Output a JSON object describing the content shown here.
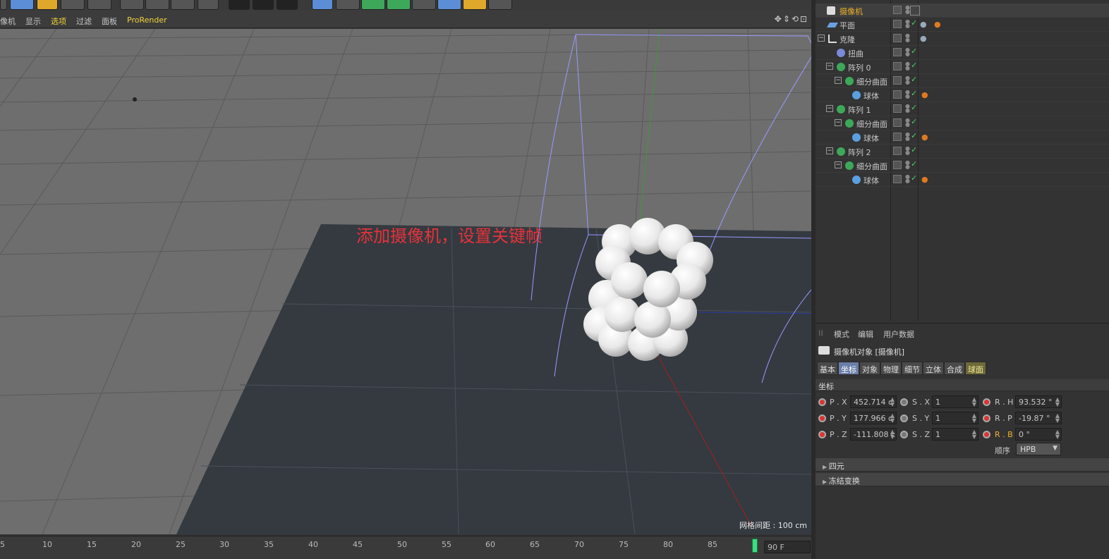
{
  "viewport_menu": {
    "items": [
      "像机",
      "显示",
      "选项",
      "过滤",
      "面板",
      "ProRender"
    ],
    "active_item": "选项"
  },
  "viewport": {
    "annotation": "添加摄像机，设置关键帧",
    "grid_spacing": "网格间距 : 100 cm"
  },
  "timeline": {
    "ticks": [
      "5",
      "10",
      "15",
      "20",
      "25",
      "30",
      "35",
      "40",
      "45",
      "50",
      "55",
      "60",
      "65",
      "70",
      "75",
      "80",
      "85"
    ],
    "current_frame": "90 F"
  },
  "objects": [
    {
      "name": "摄像机",
      "type": "camera",
      "selected": true
    },
    {
      "name": "平面",
      "type": "plane"
    },
    {
      "name": "克隆",
      "type": "cloner"
    },
    {
      "name": "扭曲",
      "type": "deformer"
    },
    {
      "name": "阵列 0",
      "type": "array"
    },
    {
      "name": "细分曲面",
      "type": "subdivision"
    },
    {
      "name": "球体",
      "type": "sphere"
    },
    {
      "name": "阵列 1",
      "type": "array"
    },
    {
      "name": "细分曲面",
      "type": "subdivision"
    },
    {
      "name": "球体",
      "type": "sphere"
    },
    {
      "name": "阵列 2",
      "type": "array"
    },
    {
      "name": "细分曲面",
      "type": "subdivision"
    },
    {
      "name": "球体",
      "type": "sphere"
    }
  ],
  "attributes": {
    "menu": [
      "模式",
      "编辑",
      "用户数据"
    ],
    "title": "摄像机对象 [摄像机]",
    "tabs": [
      "基本",
      "坐标",
      "对象",
      "物理",
      "细节",
      "立体",
      "合成",
      "球面"
    ],
    "active_tab": "坐标",
    "section": "坐标",
    "position": {
      "labels": [
        "P . X",
        "P . Y",
        "P . Z"
      ],
      "values": [
        "452.714 c",
        "177.966 c",
        "-111.808 c"
      ]
    },
    "scale": {
      "labels": [
        "S . X",
        "S . Y",
        "S . Z"
      ],
      "values": [
        "1",
        "1",
        "1"
      ]
    },
    "rotation": {
      "labels": [
        "R . H",
        "R . P",
        "R . B"
      ],
      "values": [
        "93.532 °",
        "-19.87 °",
        "0 °"
      ]
    },
    "order_label": "顺序",
    "order_value": "HPB",
    "folds": [
      "四元",
      "冻结变换"
    ]
  },
  "colors": {
    "camera_label": "#f0b12a",
    "active_menu": "#f0d23a",
    "annotation": "#e8323a",
    "keyframe_dot": "#dd3333",
    "active_tab": "#6a7fa8"
  }
}
